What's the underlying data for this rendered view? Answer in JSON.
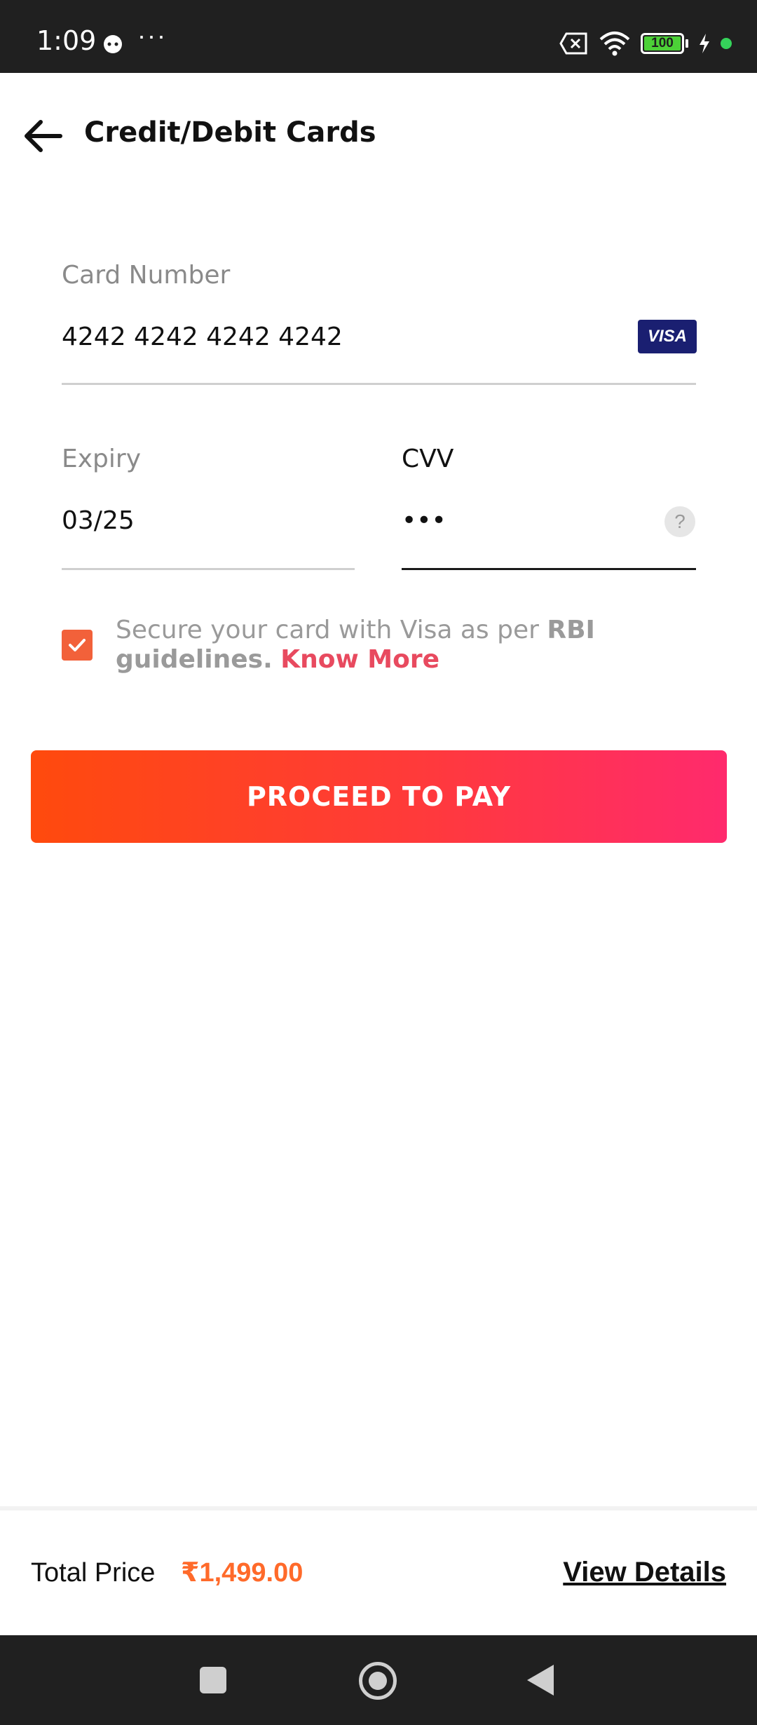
{
  "status_bar": {
    "time": "1:09",
    "dots": "···",
    "battery": "100"
  },
  "header": {
    "title": "Credit/Debit Cards"
  },
  "form": {
    "card_number_label": "Card Number",
    "card_number_value": "4242 4242 4242 4242",
    "card_brand": "VISA",
    "expiry_label": "Expiry",
    "expiry_value": "03/25",
    "cvv_label": "CVV",
    "cvv_value": "•••",
    "cvv_help": "?"
  },
  "secure": {
    "checked": true,
    "text_prefix": "Secure your card with Visa as per ",
    "text_bold": "RBI guidelines.",
    "link": "Know More"
  },
  "pay_button": {
    "label": "PROCEED TO PAY"
  },
  "footer": {
    "total_label": "Total Price",
    "total_value": "₹1,499.00",
    "view_details": "View Details"
  },
  "colors": {
    "accent": "#ff4a0d",
    "link": "#e84a5f",
    "price": "#ff6a2a",
    "visa": "#1a1f71"
  }
}
